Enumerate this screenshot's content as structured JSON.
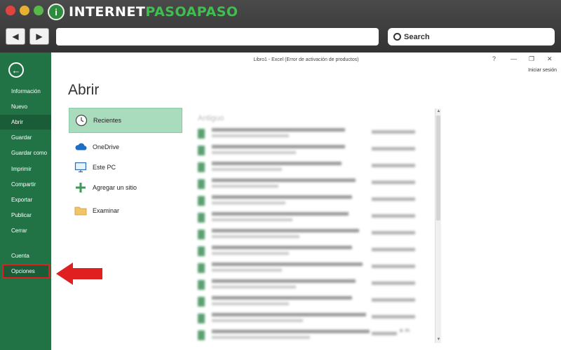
{
  "browser": {
    "logo_letter": "i",
    "logo_white": "INTERNET",
    "logo_green": "PASOAPASO",
    "back_symbol": "◀",
    "forward_symbol": "▶",
    "search_label": "Search"
  },
  "excel": {
    "window_title": "Libro1 - Excel (Error de activación de productos)",
    "help": "?",
    "minimize": "—",
    "restore": "❐",
    "close": "✕",
    "signin": "Iniciar sesión",
    "heading": "Abrir",
    "back_symbol": "←",
    "sidebar": {
      "items": [
        "Información",
        "Nuevo",
        "Abrir",
        "Guardar",
        "Guardar como",
        "Imprimir",
        "Compartir",
        "Exportar",
        "Publicar",
        "Cerrar"
      ],
      "bottom": [
        "Cuenta",
        "Opciones"
      ]
    },
    "places": [
      "Recientes",
      "OneDrive",
      "Este PC",
      "Agregar un sitio",
      "Examinar"
    ],
    "recent_heading": "Antiguo",
    "last_row_time": "a. m.",
    "colors": {
      "accent": "#217346",
      "selected": "#a9dcbd",
      "highlight": "#e02020"
    }
  }
}
